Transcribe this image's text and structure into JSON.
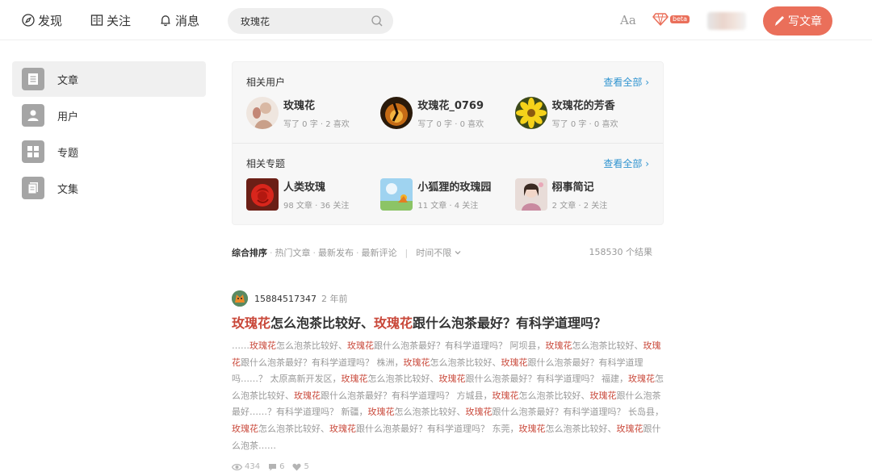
{
  "nav": {
    "discover": "发现",
    "follow": "关注",
    "messages": "消息",
    "search_value": "玫瑰花",
    "font_toggle": "Aa",
    "beta_label": "beta",
    "write_label": "写文章"
  },
  "sidebar": {
    "items": [
      {
        "label": "文章",
        "icon": "article-icon",
        "active": true
      },
      {
        "label": "用户",
        "icon": "user-icon",
        "active": false
      },
      {
        "label": "专题",
        "icon": "collection-icon",
        "active": false
      },
      {
        "label": "文集",
        "icon": "notebook-icon",
        "active": false
      }
    ]
  },
  "related_users": {
    "title": "相关用户",
    "see_all": "查看全部 ›",
    "items": [
      {
        "name": "玫瑰花",
        "meta": "写了 0 字 · 2 喜欢"
      },
      {
        "name": "玫瑰花_0769",
        "meta": "写了 0 字 · 0 喜欢"
      },
      {
        "name": "玫瑰花的芳香",
        "meta": "写了 0 字 · 0 喜欢"
      }
    ]
  },
  "related_collections": {
    "title": "相关专题",
    "see_all": "查看全部 ›",
    "items": [
      {
        "name": "人类玫瑰",
        "meta": "98 文章 · 36 关注"
      },
      {
        "name": "小狐狸的玫瑰园",
        "meta": "11 文章 · 4 关注"
      },
      {
        "name": "栩事简记",
        "meta": "2 文章 · 2 关注"
      }
    ]
  },
  "sort": {
    "options": [
      "综合排序",
      "热门文章",
      "最新发布",
      "最新评论"
    ],
    "time_filter": "时间不限",
    "result_count": "158530 个结果"
  },
  "article": {
    "author": "15884517347",
    "time": "2 年前",
    "title": {
      "hl1": "玫瑰花",
      "t1": "怎么泡茶比较好、",
      "hl2": "玫瑰花",
      "t2": "跟什么泡茶最好？有科学道理吗？"
    },
    "body": [
      {
        "t": "……",
        "h": false
      },
      {
        "t": "玫瑰花",
        "h": true
      },
      {
        "t": "怎么泡茶比较好、",
        "h": false
      },
      {
        "t": "玫瑰花",
        "h": true
      },
      {
        "t": "跟什么泡茶最好？有科学道理吗？ 阿坝县，",
        "h": false
      },
      {
        "t": "玫瑰花",
        "h": true
      },
      {
        "t": "怎么泡茶比较好、",
        "h": false
      },
      {
        "t": "玫瑰花",
        "h": true
      },
      {
        "t": "跟什么泡茶最好？有科学道理吗？ 株洲，",
        "h": false
      },
      {
        "t": "玫瑰花",
        "h": true
      },
      {
        "t": "怎么泡茶比较好、",
        "h": false
      },
      {
        "t": "玫瑰花",
        "h": true
      },
      {
        "t": "跟什么泡茶最好？有科学道理吗……？ 太原高新开发区，",
        "h": false
      },
      {
        "t": "玫瑰花",
        "h": true
      },
      {
        "t": "怎么泡茶比较好、",
        "h": false
      },
      {
        "t": "玫瑰花",
        "h": true
      },
      {
        "t": "跟什么泡茶最好？有科学道理吗？ 福建，",
        "h": false
      },
      {
        "t": "玫瑰花",
        "h": true
      },
      {
        "t": "怎么泡茶比较好、",
        "h": false
      },
      {
        "t": "玫瑰花",
        "h": true
      },
      {
        "t": "跟什么泡茶最好？有科学道理吗？ 方城县，",
        "h": false
      },
      {
        "t": "玫瑰花",
        "h": true
      },
      {
        "t": "怎么泡茶比较好、",
        "h": false
      },
      {
        "t": "玫瑰花",
        "h": true
      },
      {
        "t": "跟什么泡茶最好……？有科学道理吗？ 新疆，",
        "h": false
      },
      {
        "t": "玫瑰花",
        "h": true
      },
      {
        "t": "怎么泡茶比较好、",
        "h": false
      },
      {
        "t": "玫瑰花",
        "h": true
      },
      {
        "t": "跟什么泡茶最好？有科学道理吗？ 长岛县，",
        "h": false
      },
      {
        "t": "玫瑰花",
        "h": true
      },
      {
        "t": "怎么泡茶比较好、",
        "h": false
      },
      {
        "t": "玫瑰花",
        "h": true
      },
      {
        "t": "跟什么泡茶最好？有科学道理吗？ 东莞，",
        "h": false
      },
      {
        "t": "玫瑰花",
        "h": true
      },
      {
        "t": "怎么泡茶比较好、",
        "h": false
      },
      {
        "t": "玫瑰花",
        "h": true
      },
      {
        "t": "跟什么泡茶……",
        "h": false
      }
    ],
    "views": "434",
    "comments": "6",
    "likes": "5"
  },
  "colors": {
    "accent": "#ea6f5a",
    "highlight": "#c9483a",
    "link": "#3194d0"
  }
}
